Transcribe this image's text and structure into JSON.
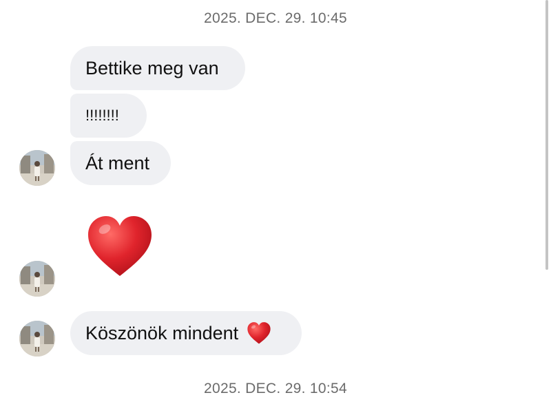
{
  "timestamps": {
    "top": "2025. DEC. 29. 10:45",
    "bottom": "2025. DEC. 29. 10:54"
  },
  "messages": [
    {
      "text": "Bettike meg van"
    },
    {
      "text": "!!!!!!!!"
    },
    {
      "text": "Át ment"
    },
    {
      "emoji": "red-heart-icon"
    },
    {
      "text": "Köszönök mindent",
      "emoji": "red-heart-icon"
    }
  ],
  "colors": {
    "bubble_bg": "#eff0f3",
    "timestamp_text": "#6b6b6b",
    "heart": "#e0242c"
  }
}
